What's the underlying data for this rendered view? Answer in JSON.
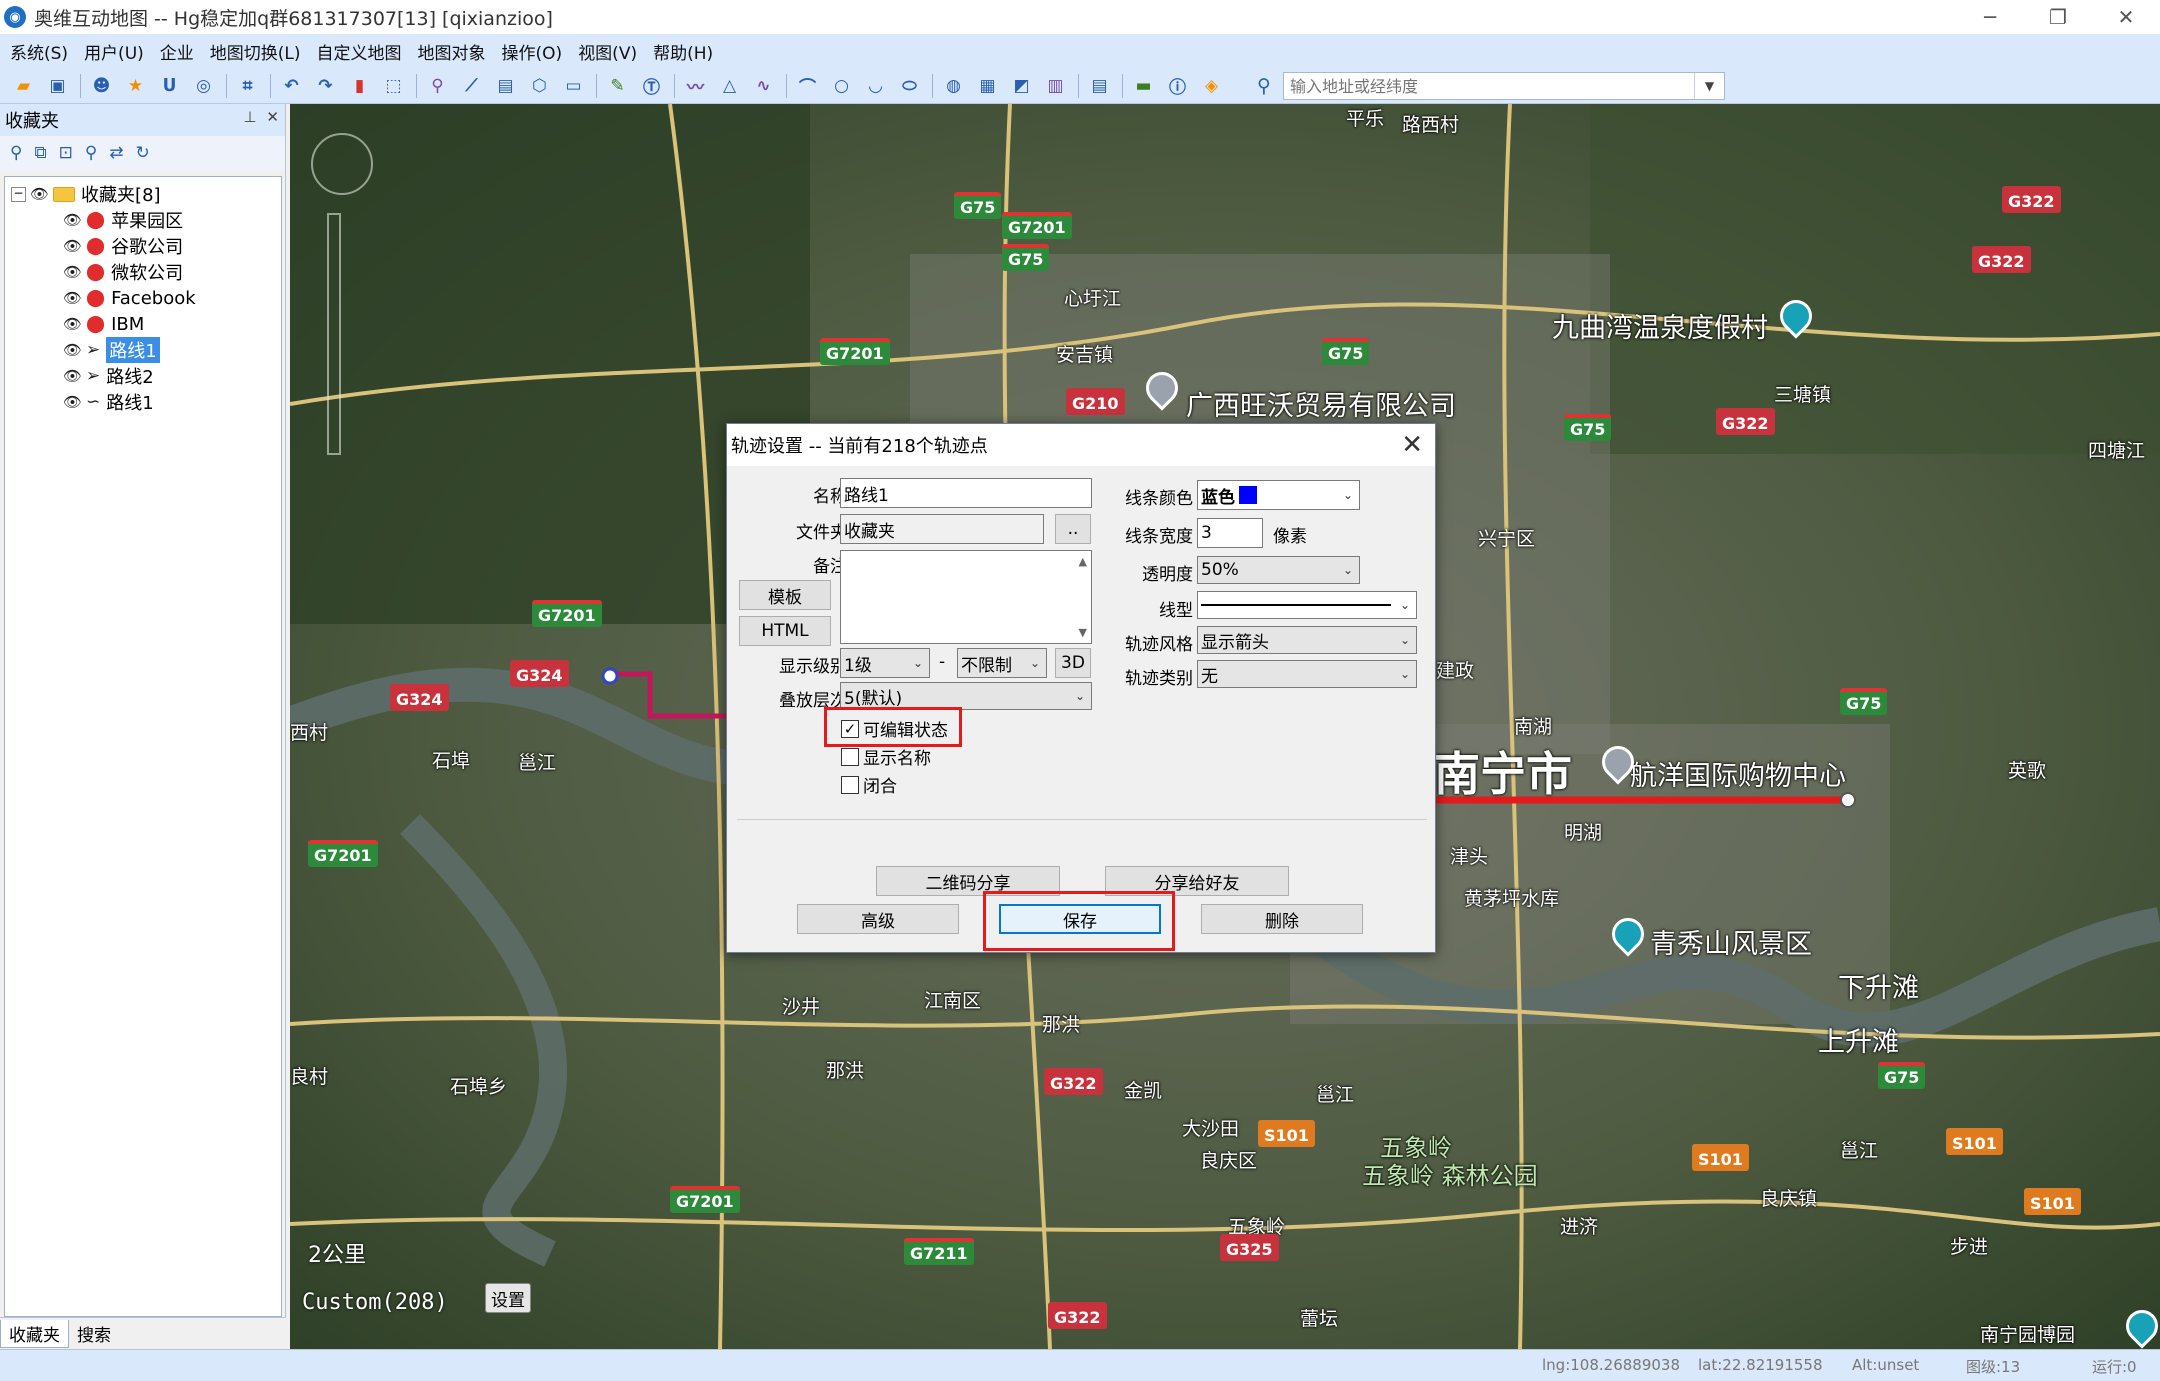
{
  "window": {
    "title": "奥维互动地图 -- Hg稳定加q群681317307[13] [qixianzioo]",
    "logo": "app-logo-icon",
    "controls": [
      "─",
      "❐",
      "✕"
    ]
  },
  "menu": [
    "系统(S)",
    "用户(U)",
    "企业",
    "地图切换(L)",
    "自定义地图",
    "地图对象",
    "操作(O)",
    "视图(V)",
    "帮助(H)"
  ],
  "search": {
    "placeholder": "输入地址或经纬度"
  },
  "panel": {
    "title": "收藏夹",
    "tabs": [
      "收藏夹",
      "搜索"
    ],
    "tree": {
      "root": "收藏夹[8]",
      "items": [
        {
          "label": "苹果园区",
          "type": "pin"
        },
        {
          "label": "谷歌公司",
          "type": "pin"
        },
        {
          "label": "微软公司",
          "type": "pin"
        },
        {
          "label": "Facebook",
          "type": "pin"
        },
        {
          "label": "IBM",
          "type": "pin"
        },
        {
          "label": "路线1",
          "type": "route",
          "selected": true
        },
        {
          "label": "路线2",
          "type": "route"
        },
        {
          "label": "路线1",
          "type": "track"
        }
      ]
    }
  },
  "map": {
    "labels": {
      "pingle": "平乐",
      "luxicun": "路西村",
      "xinxujiang": "心圩江",
      "anjizhen": "安吉镇",
      "jiuqu": "九曲湾温泉度假村",
      "guangxi": "广西旺沃贸易有限公司",
      "santang": "三塘镇",
      "sitang": "四塘江",
      "xingning": "兴宁区",
      "nanhu": "南湖",
      "nanning": "南宁市",
      "hangyang": "航洋国际购物中心",
      "yingge": "英歌",
      "mingjiang": "明湖",
      "jintou": "津头",
      "qingxiu": "青秀山风景区",
      "huangmao": "黄茅坪水库",
      "xiashengtan": "下升滩",
      "shangshengtan": "上升滩",
      "jiangnan": "江南区",
      "naxun": "那洪",
      "naxun2": "那洪",
      "jinkai": "金凯",
      "dashatian": "大沙田",
      "liangqing": "良庆区",
      "wuxiangling": "五象岭",
      "wuxiangpark": "五象岭\n森林公园",
      "yongjiang": "邕江",
      "yongjiang2": "邕江",
      "yongjiang3": "邕江",
      "liangqingzhen": "良庆镇",
      "jinji": "进济",
      "bujin": "步进",
      "shabu": "石埠",
      "shabuxiang": "石埠乡",
      "shajing": "沙井",
      "xicun": "西村",
      "liangcun": "良村",
      "leiwan": "蕾坛",
      "nanningyuan": "南宁园博园",
      "jianzheng": "建政"
    },
    "shields": {
      "g75a": "G75",
      "g7201a": "G7201",
      "g75b": "G75",
      "g7201b": "G7201",
      "g210": "G210",
      "g75c": "G75",
      "g322a": "G322",
      "g322b": "G322",
      "g75d": "G75",
      "g322c": "G322",
      "g7201c": "G7201",
      "g324a": "G324",
      "g324b": "G324",
      "g7201d": "G7201",
      "g75e": "G75",
      "g322d": "G322",
      "s101a": "S101",
      "s101b": "S101",
      "s101c": "S101",
      "s101d": "S101",
      "g7201e": "G7201",
      "g7211": "G7211",
      "g325": "G325",
      "g322e": "G322",
      "g75f": "G75"
    },
    "scale": "2公里",
    "custom": "Custom(208)",
    "set_btn": "设置"
  },
  "status": {
    "lng": "lng:108.26889038",
    "lat": "lat:22.82191558",
    "alt": "Alt:unset",
    "level": "图级:13",
    "run": "运行:0"
  },
  "dialog": {
    "title": "轨迹设置 -- 当前有218个轨迹点",
    "name_label": "名称",
    "name_value": "路线1",
    "folder_label": "文件夹",
    "folder_value": "收藏夹",
    "folder_btn": "..",
    "note_label": "备注",
    "template_btn": "模板",
    "html_btn": "HTML",
    "level_label": "显示级别",
    "level_value": "1级",
    "level_dash": "-",
    "level_max": "不限制",
    "btn_3d": "3D",
    "layer_label": "叠放层次",
    "layer_value": "5(默认)",
    "editable": "可编辑状态",
    "showname": "显示名称",
    "closed": "闭合",
    "color_label": "线条颜色",
    "color_value": "蓝色",
    "color_hex": "#0000ff",
    "width_label": "线条宽度",
    "width_value": "3",
    "width_unit": "像素",
    "opacity_label": "透明度",
    "opacity_value": "50%",
    "linetype_label": "线型",
    "style_label": "轨迹风格",
    "style_value": "显示箭头",
    "category_label": "轨迹类别",
    "category_value": "无",
    "qr_btn": "二维码分享",
    "share_btn": "分享给好友",
    "adv_btn": "高级",
    "save_btn": "保存",
    "del_btn": "删除"
  }
}
